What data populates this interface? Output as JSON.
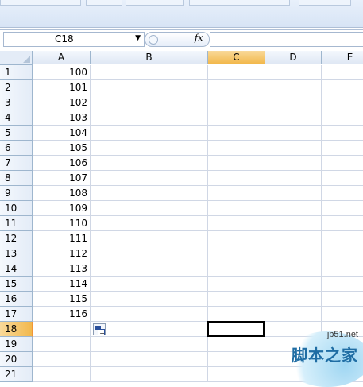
{
  "name_box": {
    "value": "C18"
  },
  "formula_bar": {
    "fx_label": "fx",
    "value": ""
  },
  "columns": [
    {
      "label": "",
      "selected": false
    },
    {
      "label": "A",
      "selected": false
    },
    {
      "label": "B",
      "selected": false
    },
    {
      "label": "C",
      "selected": true
    },
    {
      "label": "D",
      "selected": false
    },
    {
      "label": "E",
      "selected": false
    }
  ],
  "rows": [
    {
      "num": "1",
      "a": "100"
    },
    {
      "num": "2",
      "a": "101"
    },
    {
      "num": "3",
      "a": "102"
    },
    {
      "num": "4",
      "a": "103"
    },
    {
      "num": "5",
      "a": "104"
    },
    {
      "num": "6",
      "a": "105"
    },
    {
      "num": "7",
      "a": "106"
    },
    {
      "num": "8",
      "a": "107"
    },
    {
      "num": "9",
      "a": "108"
    },
    {
      "num": "10",
      "a": "109"
    },
    {
      "num": "11",
      "a": "110"
    },
    {
      "num": "12",
      "a": "111"
    },
    {
      "num": "13",
      "a": "112"
    },
    {
      "num": "14",
      "a": "113"
    },
    {
      "num": "15",
      "a": "114"
    },
    {
      "num": "16",
      "a": "115"
    },
    {
      "num": "17",
      "a": "116"
    },
    {
      "num": "18",
      "a": ""
    },
    {
      "num": "19",
      "a": ""
    },
    {
      "num": "20",
      "a": ""
    },
    {
      "num": "21",
      "a": ""
    }
  ],
  "active_cell": "C18",
  "active_row": "18",
  "watermark": {
    "site": "jb51.net",
    "cn": "脚本之家"
  },
  "colors": {
    "selected_header": "#f2b84c",
    "grid_line": "#d0d7e5",
    "header_border": "#9eb6ce"
  }
}
